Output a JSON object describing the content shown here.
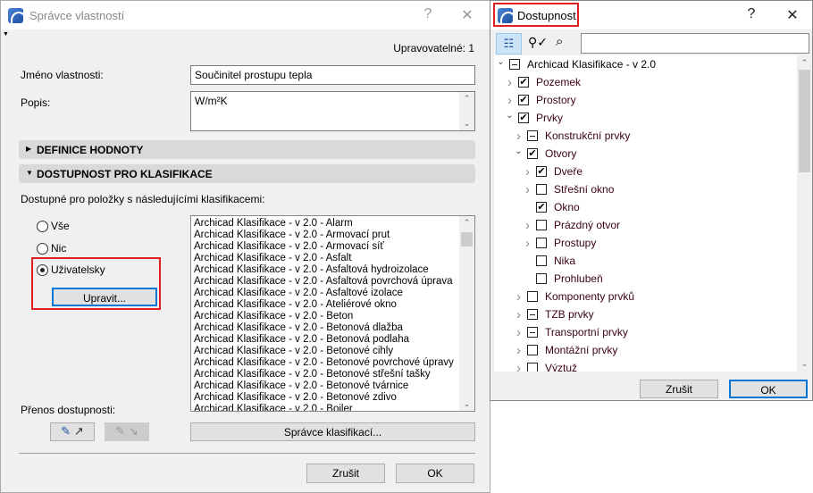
{
  "left_dialog": {
    "title": "Správce vlastností",
    "help": "?",
    "close": "✕",
    "editable": "Upravovatelné: 1",
    "name_label": "Jméno vlastnosti:",
    "name_value": "Součinitel prostupu tepla",
    "desc_label": "Popis:",
    "desc_value": "W/m²K",
    "section1": "DEFINICE HODNOTY",
    "section2": "DOSTUPNOST PRO KLASIFIKACE",
    "available_label": "Dostupné pro položky s následujícími klasifikacemi:",
    "radios": [
      {
        "label": "Vše",
        "selected": false
      },
      {
        "label": "Nic",
        "selected": false
      },
      {
        "label": "Uživatelsky",
        "selected": true
      }
    ],
    "edit_button": "Upravit...",
    "classifications": [
      "Archicad Klasifikace - v 2.0 - Alarm",
      "Archicad Klasifikace - v 2.0 - Armovací prut",
      "Archicad Klasifikace - v 2.0 - Armovací síť",
      "Archicad Klasifikace - v 2.0 - Asfalt",
      "Archicad Klasifikace - v 2.0 - Asfaltová hydroizolace",
      "Archicad Klasifikace - v 2.0 - Asfaltová povrchová úprava",
      "Archicad Klasifikace - v 2.0 - Asfaltové izolace",
      "Archicad Klasifikace - v 2.0 - Ateliérové okno",
      "Archicad Klasifikace - v 2.0 - Beton",
      "Archicad Klasifikace - v 2.0 - Betonová dlažba",
      "Archicad Klasifikace - v 2.0 - Betonová podlaha",
      "Archicad Klasifikace - v 2.0 - Betonové cihly",
      "Archicad Klasifikace - v 2.0 - Betonové povrchové úpravy",
      "Archicad Klasifikace - v 2.0 - Betonové střešní tašky",
      "Archicad Klasifikace - v 2.0 - Betonové tvárnice",
      "Archicad Klasifikace - v 2.0 - Betonové zdivo",
      "Archicad Klasifikace - v 2.0 - Boiler"
    ],
    "transfer_label": "Přenos dostupnosti:",
    "manager_button": "Správce klasifikací...",
    "cancel": "Zrušit",
    "ok": "OK"
  },
  "right_dialog": {
    "title": "Dostupnost",
    "help": "?",
    "close": "✕",
    "search_value": "",
    "tree": [
      {
        "label": "Archicad Klasifikace - v 2.0",
        "level": 0,
        "state": "mixed",
        "expander": "open"
      },
      {
        "label": "Pozemek",
        "level": 1,
        "state": "checked",
        "expander": "closed"
      },
      {
        "label": "Prostory",
        "level": 1,
        "state": "checked",
        "expander": "closed"
      },
      {
        "label": "Prvky",
        "level": 1,
        "state": "checked",
        "expander": "open"
      },
      {
        "label": "Konstrukční prvky",
        "level": 2,
        "state": "mixed",
        "expander": "closed"
      },
      {
        "label": "Otvory",
        "level": 2,
        "state": "checked",
        "expander": "open"
      },
      {
        "label": "Dveře",
        "level": 3,
        "state": "checked",
        "expander": "closed"
      },
      {
        "label": "Střešní okno",
        "level": 3,
        "state": "unchecked",
        "expander": "closed"
      },
      {
        "label": "Okno",
        "level": 3,
        "state": "checked",
        "expander": "none"
      },
      {
        "label": "Prázdný otvor",
        "level": 3,
        "state": "unchecked",
        "expander": "closed"
      },
      {
        "label": "Prostupy",
        "level": 3,
        "state": "unchecked",
        "expander": "closed"
      },
      {
        "label": "Nika",
        "level": 3,
        "state": "unchecked",
        "expander": "none"
      },
      {
        "label": "Prohlubeň",
        "level": 3,
        "state": "unchecked",
        "expander": "none"
      },
      {
        "label": "Komponenty prvků",
        "level": 2,
        "state": "unchecked",
        "expander": "closed"
      },
      {
        "label": "TZB prvky",
        "level": 2,
        "state": "mixed",
        "expander": "closed"
      },
      {
        "label": "Transportní prvky",
        "level": 2,
        "state": "mixed",
        "expander": "closed"
      },
      {
        "label": "Montážní prvky",
        "level": 2,
        "state": "unchecked",
        "expander": "closed"
      },
      {
        "label": "Výztuž",
        "level": 2,
        "state": "unchecked",
        "expander": "closed"
      }
    ],
    "cancel": "Zrušit",
    "ok": "OK"
  },
  "colors": {
    "highlight": "#e02020",
    "focus": "#0078d7"
  }
}
